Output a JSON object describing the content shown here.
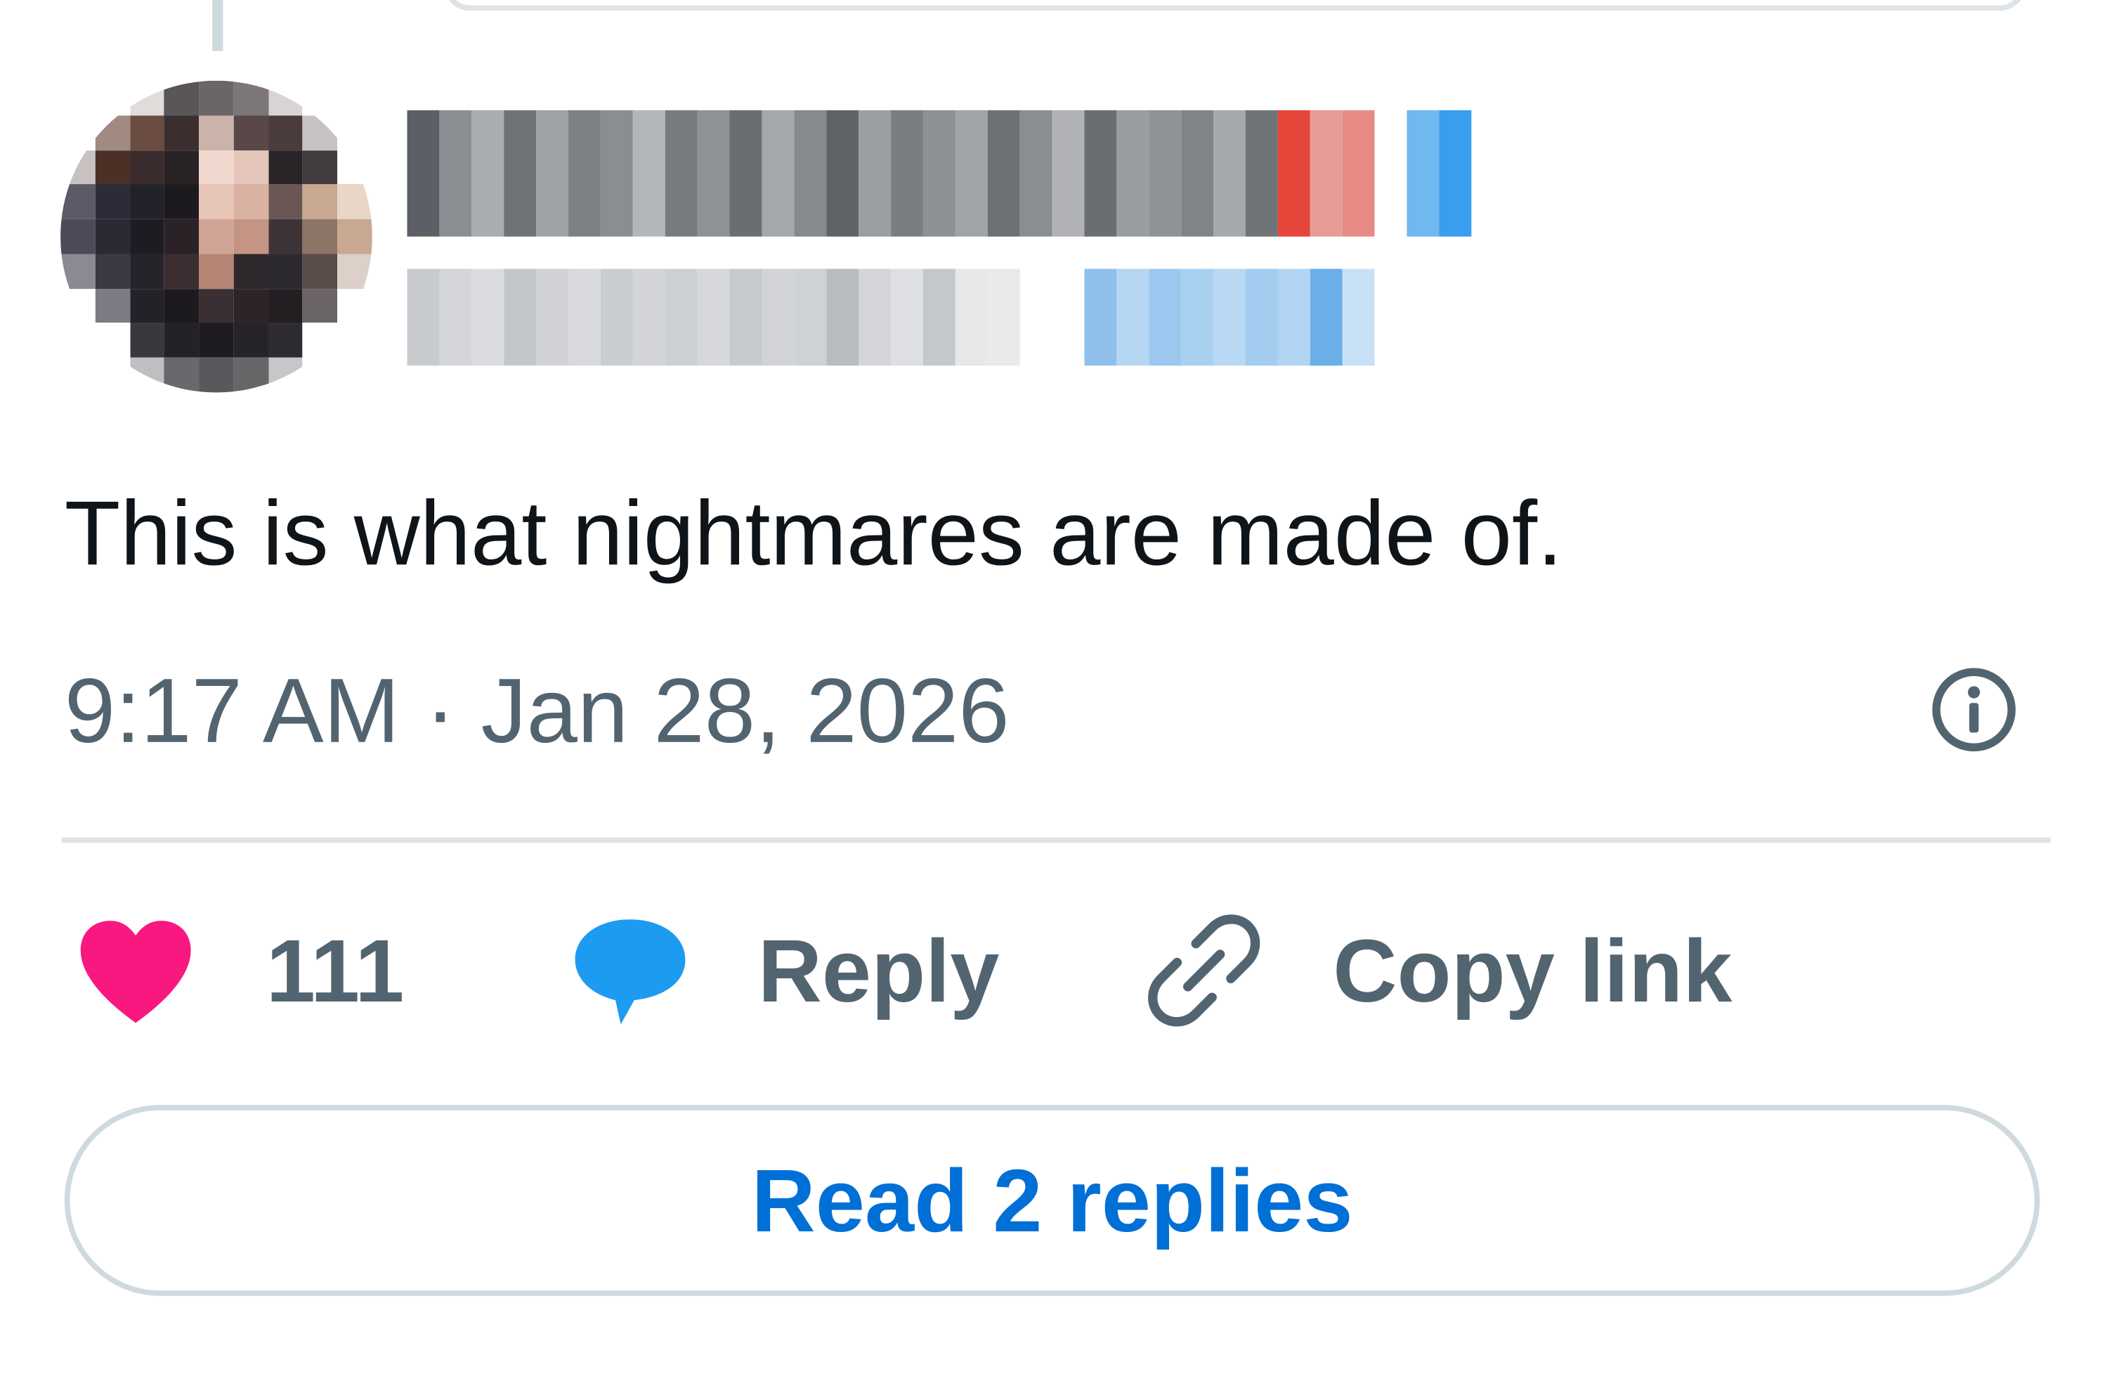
{
  "tweet": {
    "text": "This is what nightmares are made of.",
    "timestamp": "9:17 AM · Jan 28, 2026",
    "info_icon": "info-icon"
  },
  "actions": {
    "like": {
      "icon": "heart-icon",
      "count": "111",
      "color": "#f91880"
    },
    "reply": {
      "icon": "speech-bubble-icon",
      "label": "Reply",
      "color": "#1d9bf0"
    },
    "copy_link": {
      "icon": "link-icon",
      "label": "Copy link"
    }
  },
  "read_replies": {
    "label": "Read 2 replies",
    "color": "#006fd6"
  },
  "colors": {
    "text_primary": "#0f1419",
    "text_secondary": "#536471",
    "divider": "#dde3e7"
  }
}
